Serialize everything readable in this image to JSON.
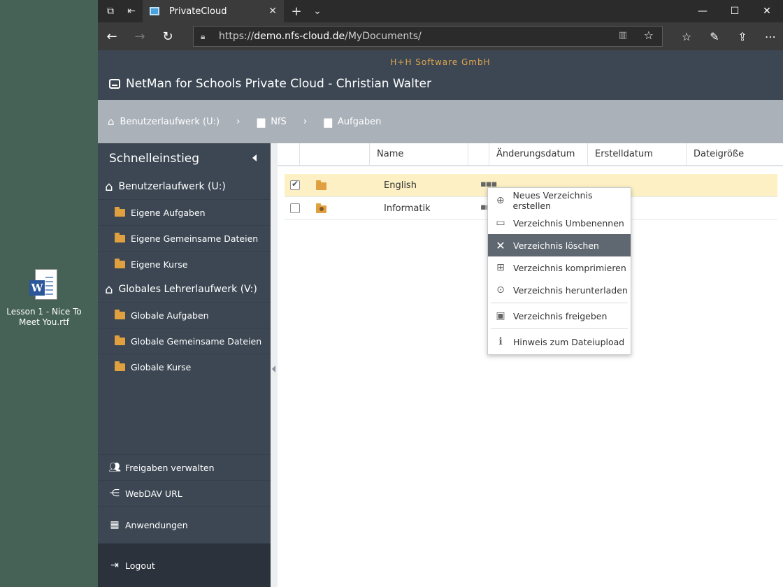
{
  "desktop": {
    "icon_label": "Lesson 1 - Nice To Meet You.rtf"
  },
  "browser": {
    "tab_title": "PrivateCloud",
    "url_prefix": "https://",
    "url_host": "demo.nfs-cloud.de",
    "url_path": "/MyDocuments/"
  },
  "app": {
    "company": "H+H Software GmbH",
    "title": "NetMan for Schools Private Cloud - Christian Walter"
  },
  "breadcrumb": [
    {
      "label": "Benutzerlaufwerk (U:)",
      "icon": "home-icon"
    },
    {
      "label": "NfS",
      "icon": "folder-icon"
    },
    {
      "label": "Aufgaben",
      "icon": "folder-icon"
    }
  ],
  "sidebar": {
    "heading": "Schnelleinstieg",
    "group1": {
      "label": "Benutzerlaufwerk (U:)",
      "items": [
        "Eigene Aufgaben",
        "Eigene Gemeinsame Dateien",
        "Eigene Kurse"
      ]
    },
    "group2": {
      "label": "Globales Lehrerlaufwerk (V:)",
      "items": [
        "Globale Aufgaben",
        "Globale Gemeinsame Dateien",
        "Globale Kurse"
      ]
    },
    "links": [
      "Freigaben verwalten",
      "WebDAV URL",
      "Anwendungen",
      "Logout"
    ]
  },
  "grid": {
    "columns": [
      "Name",
      "Änderungsdatum",
      "Erstelldatum",
      "Dateigröße"
    ],
    "rows": [
      {
        "name": "English",
        "selected": true
      },
      {
        "name": "Informatik",
        "selected": false
      }
    ]
  },
  "context_menu": {
    "items": [
      "Neues Verzeichnis erstellen",
      "Verzeichnis Umbenennen",
      "Verzeichnis löschen",
      "Verzeichnis komprimieren",
      "Verzeichnis herunterladen",
      "Verzeichnis freigeben",
      "Hinweis zum Dateiupload"
    ],
    "highlighted": "Verzeichnis löschen"
  },
  "colors": {
    "header_bg": "#3c4753",
    "accent_company": "#e0a64c",
    "selected_row": "#fdf0c4",
    "folder": "#e1a040"
  }
}
